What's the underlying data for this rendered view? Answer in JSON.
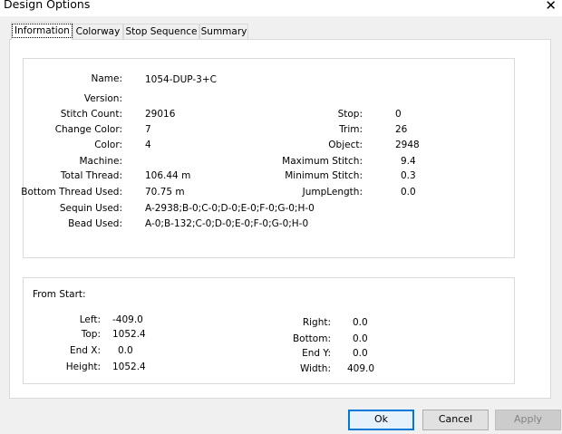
{
  "window": {
    "title": "Design Options",
    "close_glyph": "✕"
  },
  "tabs": [
    "Information",
    "Colorway",
    "Stop Sequence",
    "Summary"
  ],
  "info": {
    "name_label": "Name:",
    "name_value": "1054-DUP-3+C",
    "version_label": "Version:",
    "version_value": "",
    "stitch_count_label": "Stitch Count:",
    "stitch_count_value": "29016",
    "change_color_label": "Change Color:",
    "change_color_value": "7",
    "color_label": "Color:",
    "color_value": "4",
    "machine_label": "Machine:",
    "machine_value": "",
    "total_thread_label": "Total Thread:",
    "total_thread_value": "106.44 m",
    "bottom_thread_label": "Bottom Thread Used:",
    "bottom_thread_value": "70.75 m",
    "sequin_label": "Sequin Used:",
    "sequin_value": "A-2938;B-0;C-0;D-0;E-0;F-0;G-0;H-0",
    "bead_label": "Bead Used:",
    "bead_value": "A-0;B-132;C-0;D-0;E-0;F-0;G-0;H-0",
    "stop_label": "Stop:",
    "stop_value": "0",
    "trim_label": "Trim:",
    "trim_value": "26",
    "object_label": "Object:",
    "object_value": "2948",
    "max_stitch_label": "Maximum Stitch:",
    "max_stitch_value": "9.4",
    "min_stitch_label": "Minimum Stitch:",
    "min_stitch_value": "0.3",
    "jump_length_label": "JumpLength:",
    "jump_length_value": "0.0"
  },
  "from_start": {
    "heading": "From Start:",
    "left_label": "Left:",
    "left_value": "-409.0",
    "top_label": "Top:",
    "top_value": "1052.4",
    "endx_label": "End X:",
    "endx_value": "0.0",
    "height_label": "Height:",
    "height_value": "1052.4",
    "right_label": "Right:",
    "right_value": "0.0",
    "bottom_label": "Bottom:",
    "bottom_value": "0.0",
    "endy_label": "End Y:",
    "endy_value": "0.0",
    "width_label": "Width:",
    "width_value": "409.0"
  },
  "buttons": {
    "ok": "Ok",
    "cancel": "Cancel",
    "apply": "Apply"
  }
}
